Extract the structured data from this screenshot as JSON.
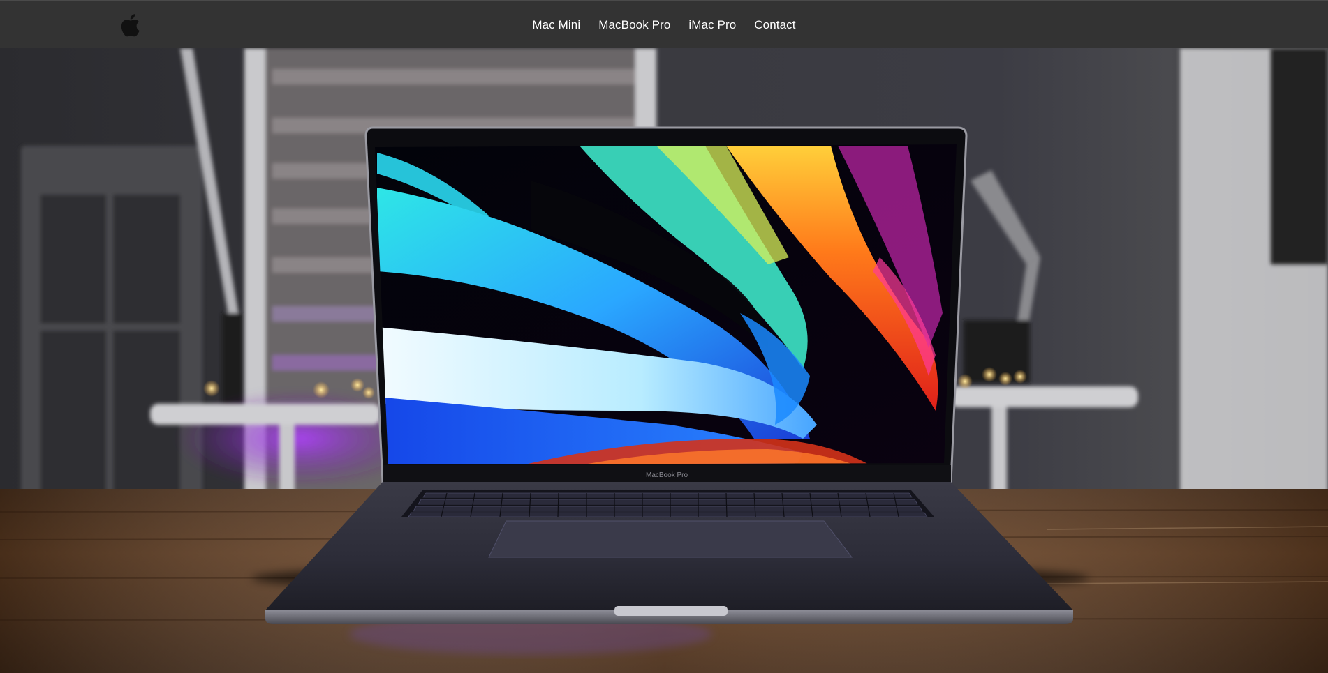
{
  "header": {
    "logo_icon": "apple-logo-icon",
    "nav": [
      {
        "label": "Mac Mini"
      },
      {
        "label": "MacBook Pro"
      },
      {
        "label": "iMac Pro"
      },
      {
        "label": "Contact"
      }
    ]
  },
  "hero": {
    "image_subject": "macbook-pro-on-wooden-desk",
    "bezel_label": "MacBook Pro"
  },
  "colors": {
    "header_bg": "#333333",
    "nav_text": "#ffffff"
  }
}
